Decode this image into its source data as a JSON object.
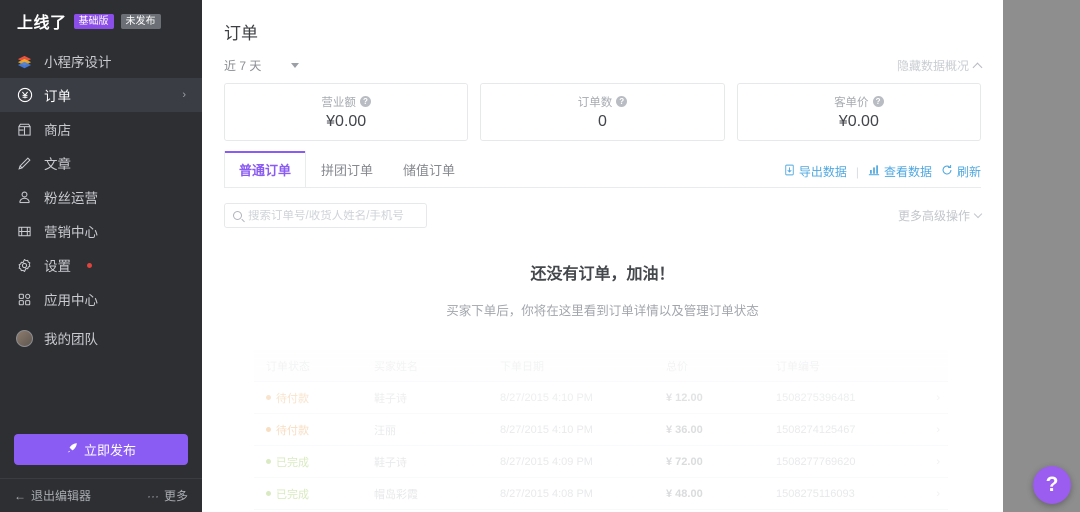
{
  "sidebar": {
    "brand": "上线了",
    "badges": [
      {
        "label": "基础版",
        "kind": "pro",
        "color": "#8b4ee8"
      },
      {
        "label": "未发布",
        "kind": "unpub",
        "color": "#6c7076"
      }
    ],
    "items": [
      {
        "label": "小程序设计",
        "icon": "layers-icon",
        "active": false,
        "chevron": false,
        "dot": false
      },
      {
        "label": "订单",
        "icon": "yen-circle-icon",
        "active": true,
        "chevron": true,
        "dot": false
      },
      {
        "label": "商店",
        "icon": "store-icon",
        "active": false,
        "chevron": false,
        "dot": false
      },
      {
        "label": "文章",
        "icon": "pen-icon",
        "active": false,
        "chevron": false,
        "dot": false
      },
      {
        "label": "粉丝运营",
        "icon": "users-icon",
        "active": false,
        "chevron": false,
        "dot": false
      },
      {
        "label": "营销中心",
        "icon": "ticket-icon",
        "active": false,
        "chevron": false,
        "dot": false
      },
      {
        "label": "设置",
        "icon": "gear-icon",
        "active": false,
        "chevron": false,
        "dot": true
      },
      {
        "label": "应用中心",
        "icon": "grid-apps-icon",
        "active": false,
        "chevron": false,
        "dot": false
      },
      {
        "label": "我的团队",
        "icon": "avatar-icon",
        "active": false,
        "chevron": false,
        "dot": false
      }
    ],
    "publish_button": "立即发布",
    "exit_editor": "退出编辑器",
    "more": "更多",
    "accent_color": "#8b5cf3"
  },
  "main": {
    "page_title": "订单",
    "date_range": "近 7 天",
    "hide_overview": "隐藏数据概况",
    "stats": [
      {
        "label": "营业额",
        "value": "¥0.00"
      },
      {
        "label": "订单数",
        "value": "0"
      },
      {
        "label": "客单价",
        "value": "¥0.00"
      }
    ],
    "tabs": [
      {
        "label": "普通订单",
        "active": true
      },
      {
        "label": "拼团订单",
        "active": false
      },
      {
        "label": "储值订单",
        "active": false
      }
    ],
    "toolbar": [
      {
        "label": "导出数据",
        "icon": "export-icon"
      },
      {
        "label": "查看数据",
        "icon": "bar-chart-icon"
      },
      {
        "label": "刷新",
        "icon": "refresh-icon"
      }
    ],
    "toolbar_separator": "|",
    "search": {
      "value": "",
      "placeholder": "搜索订单号/收货人姓名/手机号"
    },
    "advanced_ops": "更多高级操作",
    "empty_title": "还没有订单，加油！",
    "empty_subtitle": "买家下单后，你将在这里看到订单详情以及管理订单状态",
    "link_color": "#4fa8e0"
  },
  "ghost_table": {
    "headers": [
      "订单状态",
      "买家姓名",
      "下单日期",
      "总价",
      "订单编号"
    ],
    "rows": [
      {
        "status": "待付款",
        "status_color": "#e8953f",
        "buyer": "鞋子诗",
        "date": "8/27/2015 4:10 PM",
        "total": "¥ 12.00",
        "order_no": "1508275396481",
        "chevron": "›"
      },
      {
        "status": "待付款",
        "status_color": "#e8953f",
        "buyer": "汪丽",
        "date": "8/27/2015 4:10 PM",
        "total": "¥ 36.00",
        "order_no": "1508274125467",
        "chevron": "›"
      },
      {
        "status": "已完成",
        "status_color": "#8ec044",
        "buyer": "鞋子诗",
        "date": "8/27/2015 4:09 PM",
        "total": "¥ 72.00",
        "order_no": "1508277769620",
        "chevron": "›"
      },
      {
        "status": "已完成",
        "status_color": "#8ec044",
        "buyer": "帽岛彩霞",
        "date": "8/27/2015 4:08 PM",
        "total": "¥ 48.00",
        "order_no": "1508275116093",
        "chevron": "›"
      }
    ]
  },
  "overlay": {
    "help_button": "?"
  }
}
